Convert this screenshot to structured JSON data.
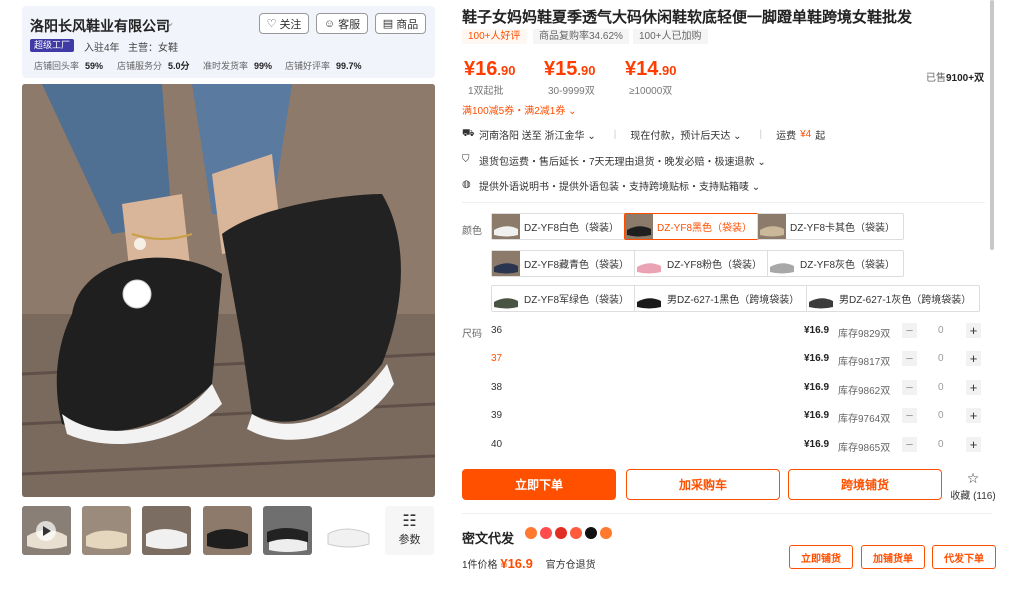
{
  "shop": {
    "name": "洛阳长风鞋业有限公司",
    "follow_label": "关注",
    "service_label": "客服",
    "goods_label": "商品",
    "badge": "超级工厂",
    "years": "入驻4年",
    "main_category": "主营：女鞋",
    "stats": [
      {
        "label": "店铺回头率",
        "value": "59%"
      },
      {
        "label": "店铺服务分",
        "value": "5.0分"
      },
      {
        "label": "准时发货率",
        "value": "99%"
      },
      {
        "label": "店铺好评率",
        "value": "99.7%"
      }
    ]
  },
  "gallery": {
    "params_label": "参数"
  },
  "product": {
    "title": "鞋子女妈妈鞋夏季透气大码休闲鞋软底轻便一脚蹬单鞋跨境女鞋批发",
    "tags": [
      "100+人好评",
      "商品复购率34.62%",
      "100+人已加购"
    ],
    "tiers": [
      {
        "price_int": "¥16",
        "price_dec": ".90",
        "caption": "1双起批"
      },
      {
        "price_int": "¥15",
        "price_dec": ".90",
        "caption": "30-9999双"
      },
      {
        "price_int": "¥14",
        "price_dec": ".90",
        "caption": "≥10000双"
      }
    ],
    "sold_prefix": "已售",
    "sold_value": "9100+双",
    "coupon": "满100减5券・满2减1券 ⌄",
    "shipping": "河南洛阳 送至 浙江金华 ⌄",
    "stock_status": "现在付款，预计后天达 ⌄",
    "freight_label": "运费",
    "freight_value": "¥4",
    "freight_suffix": "起",
    "guarantee": "退货包运费・售后延长・7天无理由退货・晚发必赔・极速退款 ⌄",
    "crossborder": "提供外语说明书・提供外语包装・支持跨境贴标・支持贴箱唛 ⌄"
  },
  "color_label": "颜色",
  "colors": [
    {
      "label": "DZ-YF8白色（袋装）",
      "selected": false
    },
    {
      "label": "DZ-YF8黑色（袋装）",
      "selected": true
    },
    {
      "label": "DZ-YF8卡其色（袋装）",
      "selected": false
    },
    {
      "label": "DZ-YF8藏青色（袋装）",
      "selected": false
    },
    {
      "label": "DZ-YF8粉色（袋装）",
      "selected": false
    },
    {
      "label": "DZ-YF8灰色（袋装）",
      "selected": false
    },
    {
      "label": "DZ-YF8军绿色（袋装）",
      "selected": false
    },
    {
      "label": "男DZ-627-1黑色（跨境袋装）",
      "selected": false
    },
    {
      "label": "男DZ-627-1灰色（跨境袋装）",
      "selected": false
    }
  ],
  "size_label": "尺码",
  "sizes": [
    {
      "size": "36",
      "price": "¥16.9",
      "stock": "库存9829双",
      "qty": "0"
    },
    {
      "size": "37",
      "price": "¥16.9",
      "stock": "库存9817双",
      "qty": "0"
    },
    {
      "size": "38",
      "price": "¥16.9",
      "stock": "库存9862双",
      "qty": "0"
    },
    {
      "size": "39",
      "price": "¥16.9",
      "stock": "库存9764双",
      "qty": "0"
    },
    {
      "size": "40",
      "price": "¥16.9",
      "stock": "库存9865双",
      "qty": "0"
    }
  ],
  "actions": {
    "order": "立即下单",
    "cart": "加采购车",
    "crossborder": "跨境铺货",
    "favorite": "收藏 (116)"
  },
  "dropship": {
    "title": "密文代发",
    "price_label": "1件价格",
    "price": "¥16.9",
    "warehouse": "官方仓退货",
    "btn_now": "立即铺货",
    "btn_add": "加铺货单",
    "btn_dropship": "代发下单"
  },
  "colors_theme": {
    "accent": "#ff5000",
    "price": "#ff3d00",
    "badge": "#3f3aa5"
  }
}
